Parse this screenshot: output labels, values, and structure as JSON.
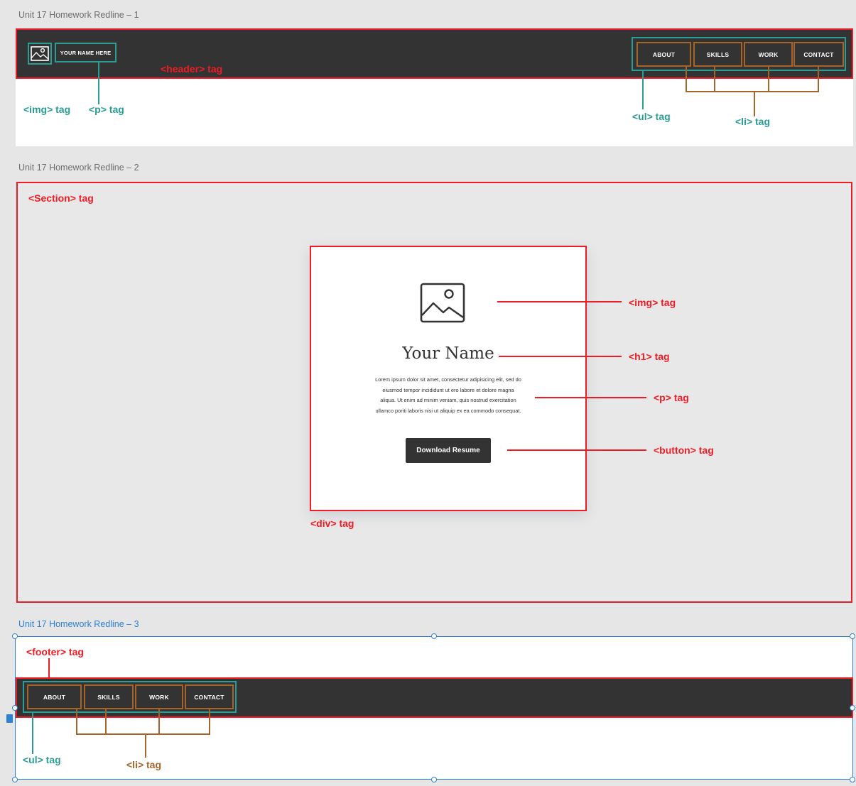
{
  "artboards": [
    {
      "title": "Unit 17 Homework Redline – 1"
    },
    {
      "title": "Unit 17 Homework Redline – 2"
    },
    {
      "title": "Unit 17 Homework Redline – 3"
    }
  ],
  "header": {
    "name_text": "YOUR NAME HERE",
    "nav": [
      "ABOUT",
      "SKILLS",
      "WORK",
      "CONTACT"
    ]
  },
  "hero": {
    "heading": "Your Name",
    "paragraph_lines": [
      "Lorem ipsum dolor sit amet, consectetur adipisicing elit, sed do",
      "eiusmod tempor incididunt ut ero labore et dolore magna",
      "aliqua. Ut enim ad minim veniam, quis nostrud exercitation",
      "ullamco poriti laboris nisi ut aliquip ex ea commodo consequat."
    ],
    "button_label": "Download Resume"
  },
  "footer": {
    "nav": [
      "ABOUT",
      "SKILLS",
      "WORK",
      "CONTACT"
    ]
  },
  "annotations": {
    "header_tag": "<header> tag",
    "img_tag": "<img> tag",
    "p_tag": "<p> tag",
    "ul_tag": "<ul> tag",
    "li_tag": "<li> tag",
    "section_tag": "<Section> tag",
    "h1_tag": "<h1> tag",
    "button_tag": "<button> tag",
    "div_tag": "<div> tag",
    "footer_tag": "<footer> tag"
  },
  "colors": {
    "annotation_red": "#ee1c24",
    "annotation_teal": "#2a9d96",
    "annotation_brown": "#a5642a",
    "dark_bar": "#333333",
    "selection_blue": "#2f80d1"
  }
}
